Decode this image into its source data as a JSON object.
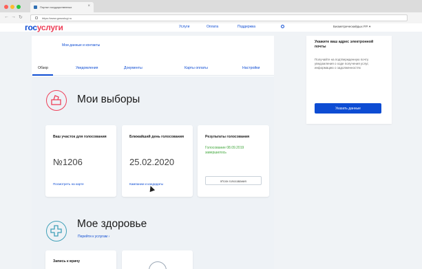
{
  "browser": {
    "tab_title": "Портал государственных",
    "tab_close": "×",
    "back": "←",
    "forward": "→",
    "reload": "↻",
    "url": "https://www.gosuslugi.ru"
  },
  "header": {
    "logo_part1": "гос",
    "logo_part2": "услуги",
    "nav": [
      "Услуги",
      "Оплата",
      "Поддержка"
    ],
    "user": "Биометрическийдых Р.Р. ▾"
  },
  "main": {
    "my_data_link": "Мои данные и контакты",
    "tabs": [
      {
        "label": "Обзор",
        "active": true
      },
      {
        "label": "Уведомления"
      },
      {
        "label": "Документы"
      },
      {
        "label": "Карты оплаты"
      },
      {
        "label": "Настройки"
      }
    ],
    "elections": {
      "title": "Мои выборы",
      "cards": [
        {
          "title": "Ваш участок для голосования",
          "big": "№1206",
          "link": "Посмотреть на карте"
        },
        {
          "title": "Ближайший день голосования",
          "big": "25.02.2020",
          "link": "Кампании и кандидаты"
        },
        {
          "title": "Результаты голосования",
          "status": "Голосование 08.09.2019 завершилось",
          "button": "Итоги голосования"
        }
      ]
    },
    "health": {
      "title": "Мое здоровье",
      "link": "Перейти к услугам ›",
      "card_title": "Запись к врачу"
    }
  },
  "aside": {
    "title": "Укажите ваш адрес электронной почты",
    "text": "Получайте на подтвержденную почту уведомления о ходе получения услуг, информацию о задолженностях",
    "button": "Указать данные"
  },
  "colors": {
    "accent": "#0d4cd3",
    "brand_red": "#ee3f58",
    "success": "#3fa63a"
  }
}
